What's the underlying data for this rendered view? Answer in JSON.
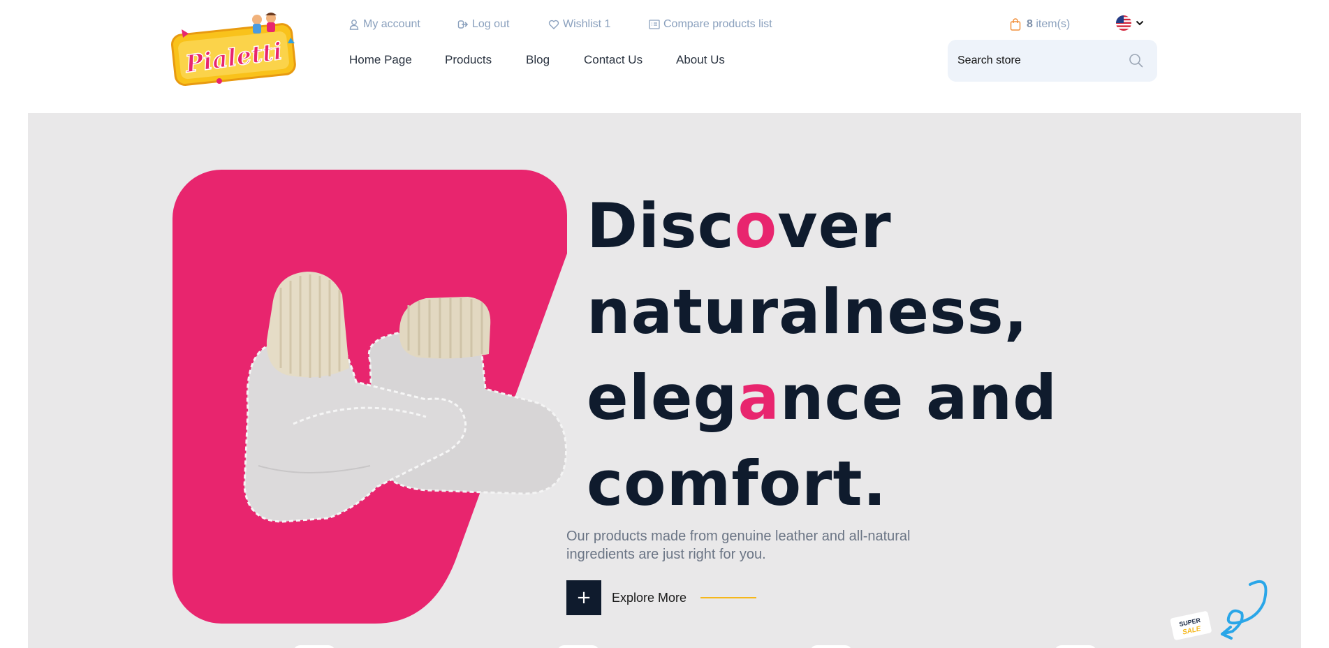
{
  "header": {
    "logo_text": "Pialetti",
    "util_links": {
      "account": "My account",
      "logout": "Log out",
      "wishlist": "Wishlist 1",
      "compare": "Compare products list"
    },
    "cart": {
      "count": "8",
      "label": "item(s)"
    },
    "language_icon": "us-flag-icon",
    "nav": [
      "Home Page",
      "Products",
      "Blog",
      "Contact Us",
      "About Us"
    ],
    "search": {
      "placeholder": "Search store"
    }
  },
  "hero": {
    "headline": {
      "line1_a": "Disc",
      "line1_hl": "o",
      "line1_b": "ver",
      "line2": "naturalness,",
      "line3_a": "eleg",
      "line3_hl": "a",
      "line3_b": "nce and",
      "line4": "comfort."
    },
    "description": "Our products made from genuine leather and all-natural ingredients are just right for you.",
    "cta": {
      "icon": "+",
      "label": "Explore More"
    },
    "sale_sticker": {
      "line1": "SUPER",
      "line2": "SALE"
    }
  },
  "colors": {
    "accent": "#e8256e",
    "navy": "#0f1b2d",
    "muted_link": "#8aa0bd",
    "hero_bg": "#e9e8e9",
    "cta_line": "#f5b71c"
  }
}
